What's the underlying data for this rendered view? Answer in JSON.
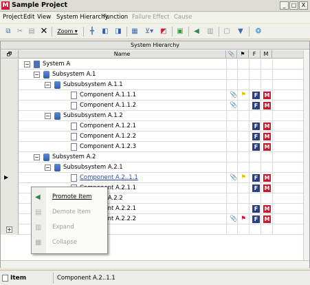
{
  "window": {
    "title": "Sample Project",
    "app_letter": "M",
    "minimize": "_",
    "maximize": "□",
    "close": "X"
  },
  "menu": [
    {
      "label": "Project",
      "enabled": true
    },
    {
      "label": "Edit",
      "enabled": true
    },
    {
      "label": "View",
      "enabled": true
    },
    {
      "label": "System Hierarchy",
      "enabled": true
    },
    {
      "label": "Function",
      "enabled": true
    },
    {
      "label": "Failure",
      "enabled": false
    },
    {
      "label": "Effect",
      "enabled": false
    },
    {
      "label": "Cause",
      "enabled": false
    }
  ],
  "toolbar": {
    "zoom_label": "Zoom ▾",
    "icons": [
      "copy-icon",
      "cut-icon",
      "paste-icon",
      "delete-icon",
      "insert-row-icon",
      "insert-left-icon",
      "insert-right-icon",
      "table-icon",
      "filter-icon",
      "flag-icon",
      "export-icon",
      "promote-icon",
      "document-icon",
      "window-icon",
      "dropdown-icon",
      "help-icon"
    ]
  },
  "grid": {
    "caption": "System Hierarchy",
    "columns": {
      "row_header": "🗗",
      "name": "Name",
      "attach": "📎",
      "flag": "⚑",
      "f": "F",
      "m": "M"
    },
    "rows": [
      {
        "label": "System A",
        "type": "folder",
        "level": 0,
        "toggle": "−",
        "attach": false,
        "flag": "",
        "f": false,
        "m": false,
        "selected": false
      },
      {
        "label": "Subsystem A.1",
        "type": "sub",
        "level": 1,
        "toggle": "−",
        "attach": false,
        "flag": "",
        "f": false,
        "m": false,
        "selected": false
      },
      {
        "label": "Subsubsystem A.1.1",
        "type": "sub",
        "level": 2,
        "toggle": "−",
        "attach": false,
        "flag": "",
        "f": false,
        "m": false,
        "selected": false
      },
      {
        "label": "Component A.1.1.1",
        "type": "comp",
        "level": 3,
        "toggle": "",
        "attach": true,
        "flag": "yellow",
        "f": true,
        "m": true,
        "selected": false
      },
      {
        "label": "Component A.1.1.2",
        "type": "comp",
        "level": 3,
        "toggle": "",
        "attach": true,
        "flag": "",
        "f": true,
        "m": true,
        "selected": false
      },
      {
        "label": "Subsubsystem A.1.2",
        "type": "sub",
        "level": 2,
        "toggle": "−",
        "attach": false,
        "flag": "",
        "f": false,
        "m": false,
        "selected": false
      },
      {
        "label": "Component A.1.2.1",
        "type": "comp",
        "level": 3,
        "toggle": "",
        "attach": false,
        "flag": "",
        "f": true,
        "m": true,
        "selected": false
      },
      {
        "label": "Component A.1.2.2",
        "type": "comp",
        "level": 3,
        "toggle": "",
        "attach": false,
        "flag": "",
        "f": true,
        "m": true,
        "selected": false
      },
      {
        "label": "Component A.1.2.3",
        "type": "comp",
        "level": 3,
        "toggle": "",
        "attach": false,
        "flag": "",
        "f": true,
        "m": true,
        "selected": false
      },
      {
        "label": "Subsystem A.2",
        "type": "sub",
        "level": 1,
        "toggle": "−",
        "attach": false,
        "flag": "",
        "f": false,
        "m": false,
        "selected": false
      },
      {
        "label": "Subsubsystem A.2.1",
        "type": "sub",
        "level": 2,
        "toggle": "−",
        "attach": false,
        "flag": "",
        "f": false,
        "m": false,
        "selected": false
      },
      {
        "label": "Component A.2..1.1",
        "type": "comp",
        "level": 3,
        "toggle": "",
        "attach": true,
        "flag": "yellow",
        "f": true,
        "m": true,
        "selected": true
      },
      {
        "label": "Component A.2.1.1",
        "type": "comp",
        "level": 3,
        "toggle": "",
        "attach": false,
        "flag": "",
        "f": true,
        "m": true,
        "selected": false
      },
      {
        "label": "Subsubsystem A.2.2",
        "type": "sub",
        "level": 2,
        "toggle": "",
        "attach": false,
        "flag": "",
        "f": false,
        "m": false,
        "selected": false
      },
      {
        "label": "Component A.2.2.1",
        "type": "comp",
        "level": 3,
        "toggle": "",
        "attach": false,
        "flag": "",
        "f": true,
        "m": true,
        "selected": false
      },
      {
        "label": "Component A.2.2.2",
        "type": "comp",
        "level": 3,
        "toggle": "",
        "attach": true,
        "flag": "red",
        "f": true,
        "m": true,
        "selected": false
      },
      {
        "label": "",
        "type": "",
        "level": 0,
        "toggle": "+",
        "attach": false,
        "flag": "",
        "f": false,
        "m": false,
        "selected": false
      }
    ]
  },
  "context_menu": [
    {
      "label": "Promote Item",
      "enabled": true,
      "icon": "promote-icon"
    },
    {
      "label": "Demote Item",
      "enabled": false,
      "icon": "demote-icon"
    },
    {
      "label": "Expand",
      "enabled": false,
      "icon": "expand-icon"
    },
    {
      "label": "Collapse",
      "enabled": false,
      "icon": "collapse-icon"
    }
  ],
  "status": {
    "type": "Item",
    "value": "Component A.2..1.1"
  }
}
